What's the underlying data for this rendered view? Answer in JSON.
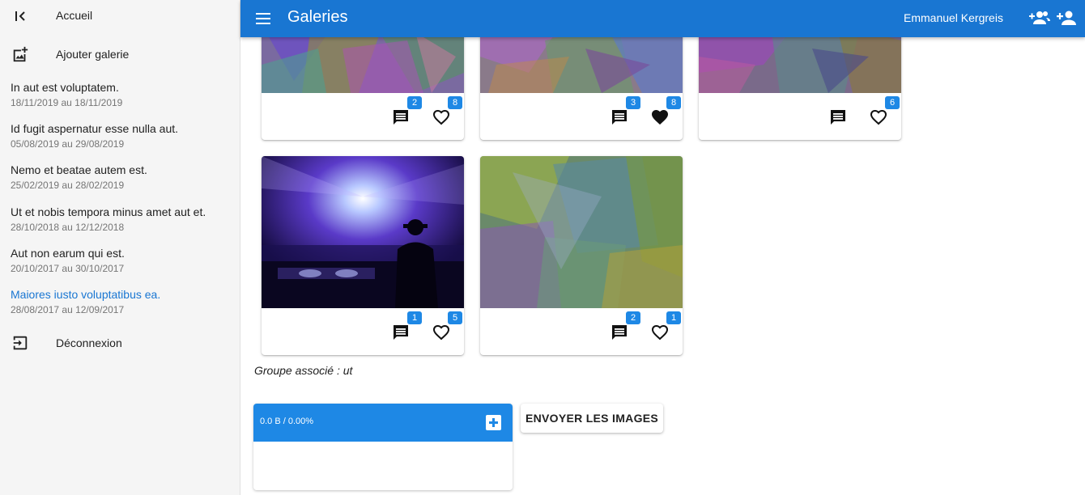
{
  "sidebar": {
    "home_label": "Accueil",
    "add_gallery_label": "Ajouter galerie",
    "galleries": [
      {
        "title": "In aut est voluptatem.",
        "dates": "18/11/2019 au 18/11/2019"
      },
      {
        "title": "Id fugit aspernatur esse nulla aut.",
        "dates": "05/08/2019 au 29/08/2019"
      },
      {
        "title": "Nemo et beatae autem est.",
        "dates": "25/02/2019 au 28/02/2019"
      },
      {
        "title": "Ut et nobis tempora minus amet aut et.",
        "dates": "28/10/2018 au 12/12/2018"
      },
      {
        "title": "Aut non earum qui est.",
        "dates": "20/10/2017 au 30/10/2017"
      },
      {
        "title": "Maiores iusto voluptatibus ea.",
        "dates": "28/08/2017 au 12/09/2017"
      }
    ],
    "logout_label": "Déconnexion"
  },
  "header": {
    "title": "Galeries",
    "user_name": "Emmanuel Kergreis"
  },
  "photos": [
    {
      "comments": "2",
      "likes": "8",
      "liked": false
    },
    {
      "comments": "3",
      "likes": "8",
      "liked": true
    },
    {
      "comments": "",
      "likes": "6",
      "liked": false
    },
    {
      "comments": "1",
      "likes": "5",
      "liked": false
    },
    {
      "comments": "2",
      "likes": "1",
      "liked": false
    }
  ],
  "group_text": "Groupe associé : ut",
  "uploader": {
    "progress_text": "0.0 B / 0.00%"
  },
  "send_button_label": "ENVOYER LES IMAGES",
  "colors": {
    "primary": "#1976d2",
    "badge": "#1e88e5",
    "sidebar_bg": "#f5f5f5"
  }
}
